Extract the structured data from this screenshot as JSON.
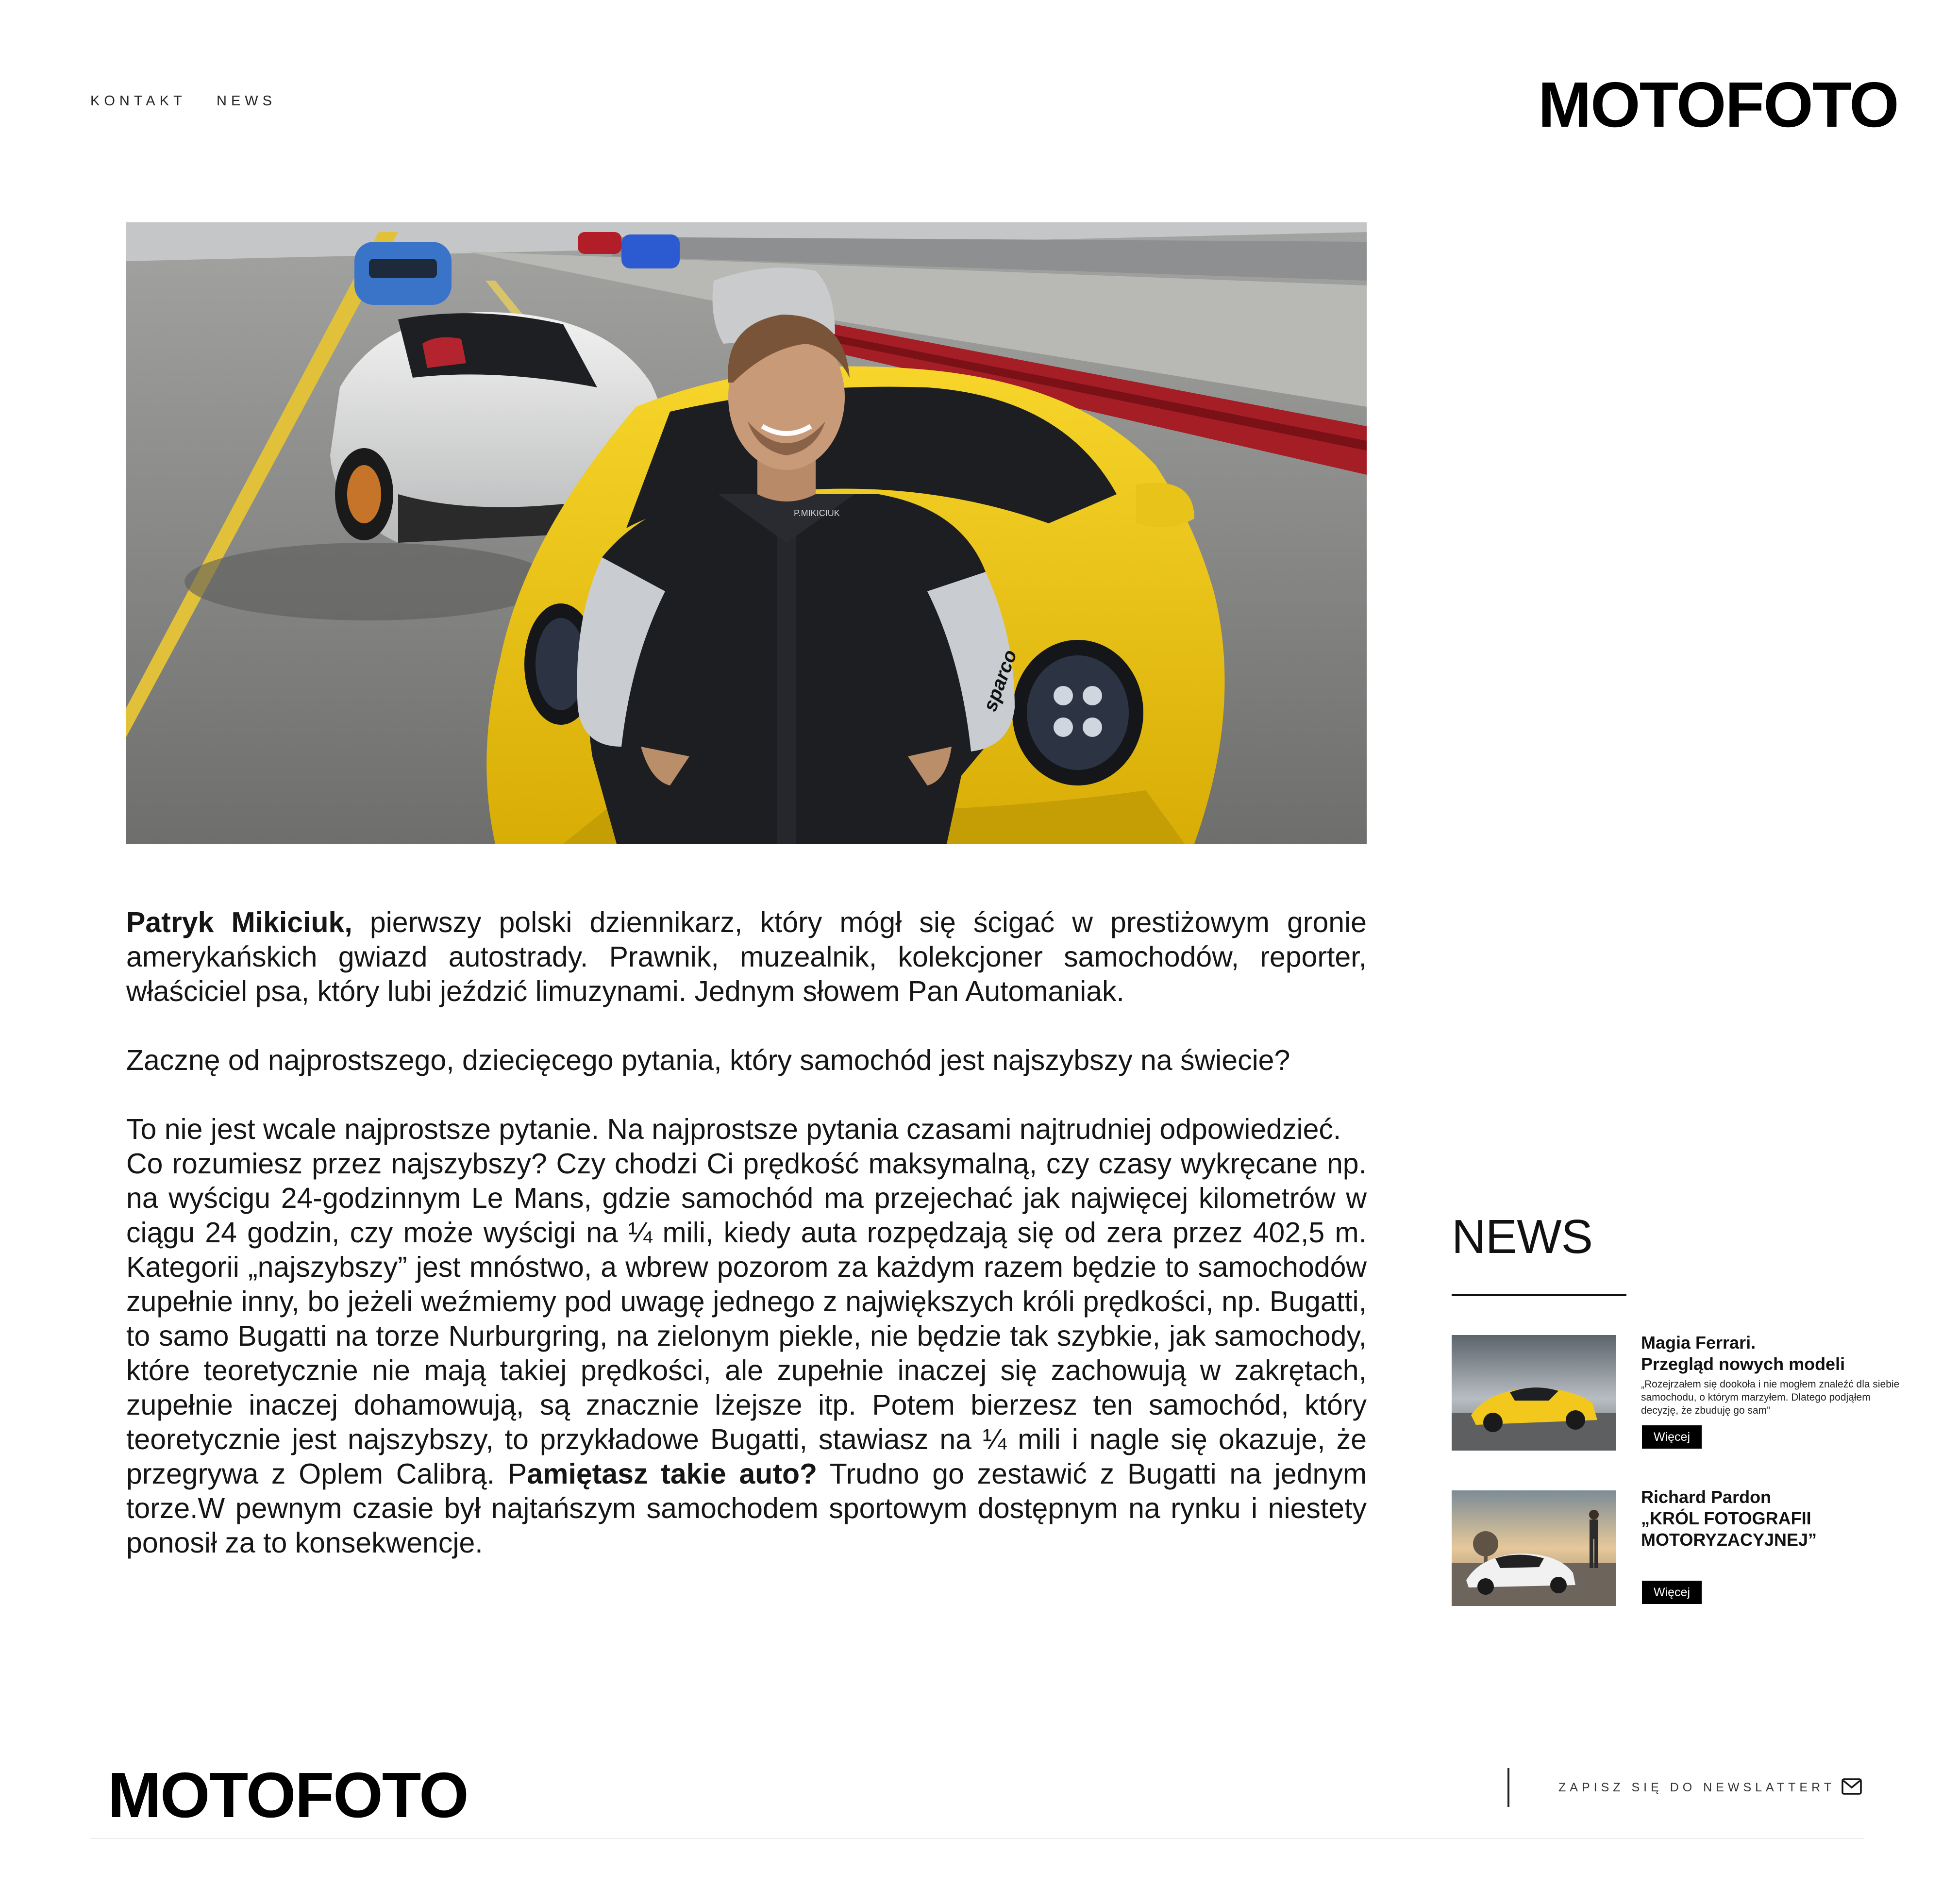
{
  "header": {
    "nav": [
      {
        "label": "KONTAKT"
      },
      {
        "label": "NEWS"
      }
    ],
    "logo": "MOTOFOTO"
  },
  "hero": {
    "image_icon": "photo-driver-racesuit-yellow-porsche-icon",
    "suit_name": "P.MIKICIUK",
    "suit_brand": "sparco"
  },
  "article": {
    "p1_bold": "Patryk Mikiciuk,",
    "p1_rest": " pierwszy polski dziennikarz, który mógł się ścigać w prestiżowym gronie amerykańskich gwiazd autostrady. Prawnik, muzealnik, kolekcjoner samochodów, reporter, właściciel psa, który lubi jeździć limuzynami. Jednym słowem Pan Automaniak.",
    "p2": "Zacznę od najprostszego, dziecięcego pytania, który samochód jest najszybszy na świecie?",
    "p3": "To nie jest wcale najprostsze pytanie. Na najprostsze pytania czasami najtrudniej odpowiedzieć.",
    "p4_start": "Co rozumiesz przez najszybszy? Czy chodzi Ci prędkość maksymalną, czy czasy wykręcane np. na wyścigu 24-godzinnym Le Mans, gdzie samochód ma przejechać jak najwięcej kilometrów w ciągu 24 godzin, czy może wyścigi na ¼ mili, kiedy auta rozpędzają się od zera przez 402,5 m. Kategorii „najszybszy” jest mnóstwo, a wbrew pozorom za każdym razem będzie to samochodów zupełnie inny, bo jeżeli weźmiemy pod uwagę jednego z największych króli prędkości, np. Bugatti, to samo Bugatti na torze Nurburgring, na zielonym piekle, nie będzie tak szybkie, jak samochody, które teoretycznie nie mają takiej prędkości, ale zupełnie inaczej się zachowują w zakrętach, zupełnie inaczej dohamowują, są znacznie lżejsze itp. Potem bierzesz ten samochód, który teoretycznie jest najszybszy, to przykładowe Bugatti, stawiasz na ¼ mili i nagle się okazuje, że przegrywa z Oplem Calibrą. P",
    "p4_bold": "amiętasz takie auto?",
    "p4_end": " Trudno go zestawić z Bugatti na jednym torze.W pewnym czasie był najtańszym samochodem sportowym dostępnym na rynku i niestety ponosił za to konsekwencje."
  },
  "news": {
    "title": "NEWS",
    "items": [
      {
        "title_line1": "Magia Ferrari.",
        "title_line2": "Przegląd nowych modeli",
        "desc": "„Rozejrzałem się dookoła i nie mogłem znaleźć dla siebie samochodu, o którym marzyłem. Dlatego podjąłem decyzję, że zbuduję go sam”",
        "button": "Więcej",
        "image_icon": "yellow-ferrari-thumbnail-icon"
      },
      {
        "title_line1": "Richard Pardon",
        "title_line2": "„KRÓL FOTOGRAFII",
        "title_line3": "MOTORYZACYJNEJ”",
        "button": "Więcej",
        "image_icon": "white-porsche-sunset-thumbnail-icon"
      }
    ]
  },
  "footer": {
    "logo": "MOTOFOTO",
    "newsletter": "ZAPISZ SIĘ DO NEWSLATTERT",
    "mail_icon": "envelope-icon"
  },
  "colors": {
    "background": "#ffffff",
    "text": "#111111",
    "button_bg": "#000000",
    "accent_yellow": "#f2cc19"
  }
}
